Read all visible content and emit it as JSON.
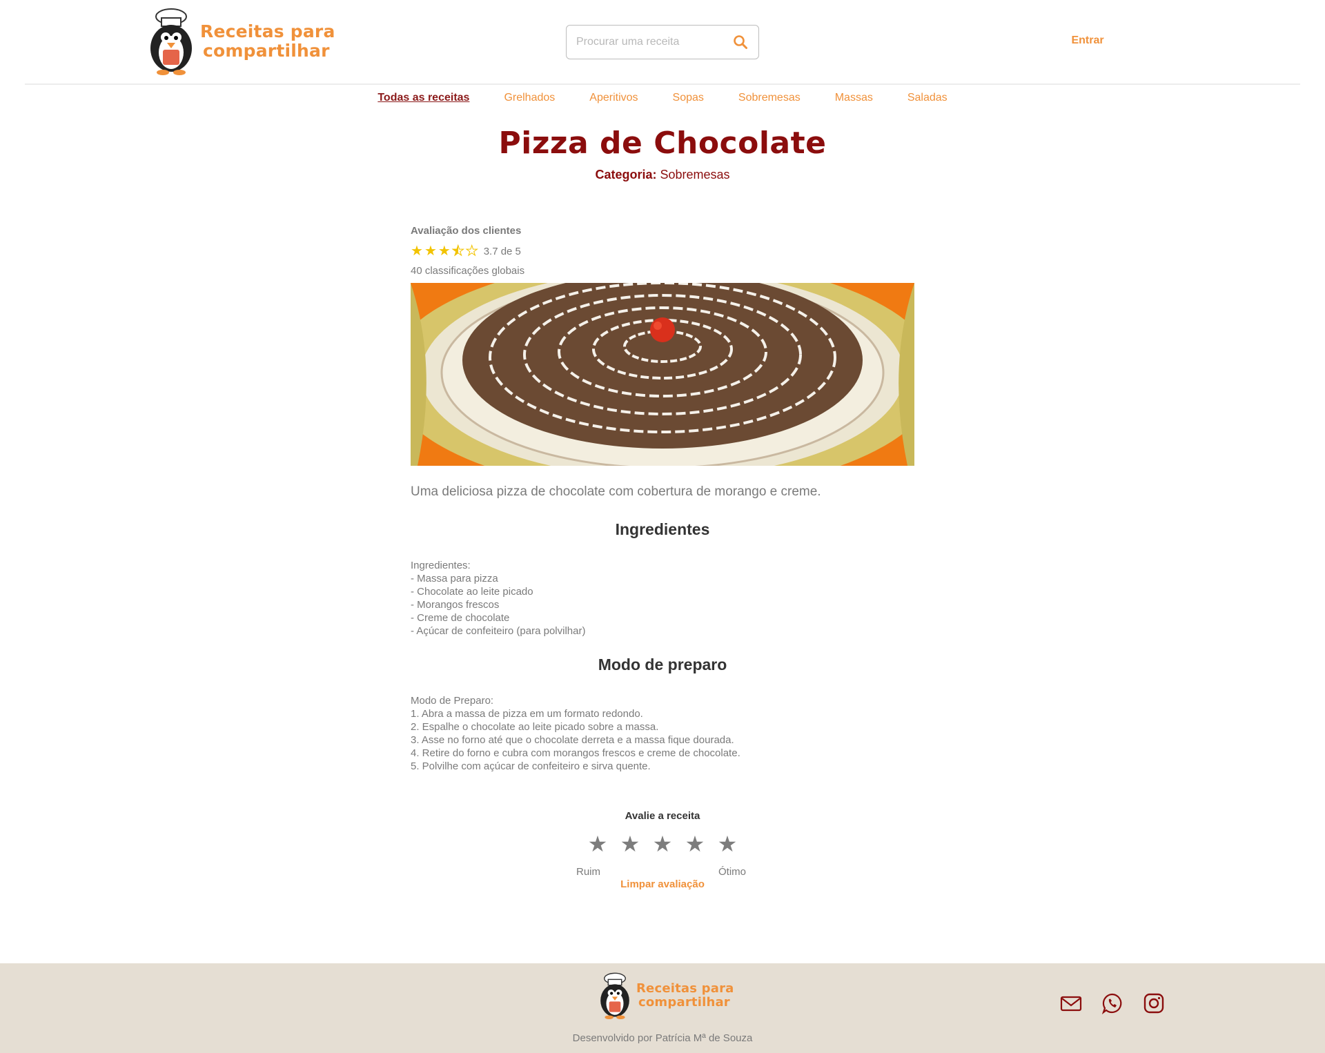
{
  "brand": {
    "line1": "Receitas para",
    "line2": "compartilhar"
  },
  "search": {
    "placeholder": "Procurar uma receita"
  },
  "header": {
    "login_label": "Entrar"
  },
  "nav": {
    "items": [
      {
        "label": "Todas as receitas",
        "active": true
      },
      {
        "label": "Grelhados"
      },
      {
        "label": "Aperitivos"
      },
      {
        "label": "Sopas"
      },
      {
        "label": "Sobremesas"
      },
      {
        "label": "Massas"
      },
      {
        "label": "Saladas"
      }
    ]
  },
  "recipe": {
    "title": "Pizza de Chocolate",
    "category_label": "Categoria:",
    "category_value": "Sobremesas",
    "rating_title": "Avaliação dos clientes",
    "rating_value": 3.7,
    "rating_text": "3.7 de 5",
    "rating_count": "40 classificações globais",
    "description": "Uma deliciosa pizza de chocolate com cobertura de morango e creme.",
    "ingredients_title": "Ingredientes",
    "ingredients": [
      "Ingredientes:",
      "- Massa para pizza",
      "- Chocolate ao leite picado",
      "- Morangos frescos",
      "- Creme de chocolate",
      "- Açúcar de confeiteiro (para polvilhar)"
    ],
    "method_title": "Modo de preparo",
    "method": [
      "Modo de Preparo:",
      "1. Abra a massa de pizza em um formato redondo.",
      "2. Espalhe o chocolate ao leite picado sobre a massa.",
      "3. Asse no forno até que o chocolate derreta e a massa fique dourada.",
      "4. Retire do forno e cubra com morangos frescos e creme de chocolate.",
      "5. Polvilhe com açúcar de confeiteiro e sirva quente."
    ]
  },
  "rate": {
    "title": "Avalie a receita",
    "low_label": "Ruim",
    "high_label": "Ótimo",
    "clear_label": "Limpar avaliação"
  },
  "footer": {
    "credit": "Desenvolvido por Patrícia Mª de Souza"
  },
  "colors": {
    "accent": "#f0913a",
    "brand_dark": "#8b0d0d",
    "footer_bg": "#e5ded3",
    "star": "#f2c300"
  },
  "icons": [
    "penguin-chef-logo",
    "search-icon",
    "star-icon",
    "mail-icon",
    "whatsapp-icon",
    "instagram-icon"
  ]
}
